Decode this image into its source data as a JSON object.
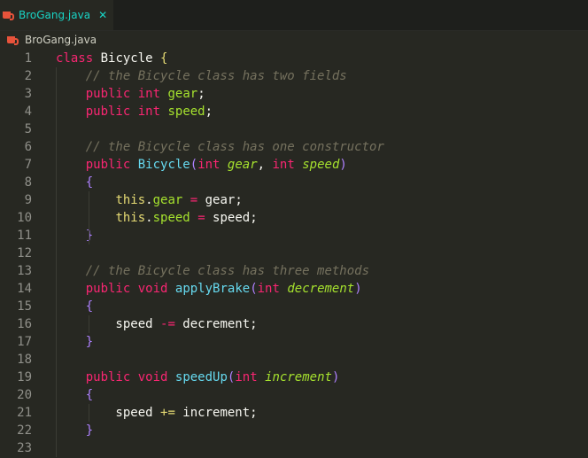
{
  "tab": {
    "label": "BroGang.java",
    "close_glyph": "✕",
    "icon": "java-file-icon"
  },
  "breadcrumb": {
    "label": "BroGang.java",
    "icon": "java-file-icon"
  },
  "editor": {
    "line_numbers": [
      "1",
      "2",
      "3",
      "4",
      "5",
      "6",
      "7",
      "8",
      "9",
      "10",
      "11",
      "12",
      "13",
      "14",
      "15",
      "16",
      "17",
      "18",
      "19",
      "20",
      "21",
      "22",
      "23"
    ],
    "lines": [
      [
        [
          "kw",
          "class"
        ],
        [
          "pl",
          " "
        ],
        [
          "cls",
          "Bicycle"
        ],
        [
          "pl",
          " "
        ],
        [
          "br",
          "{"
        ]
      ],
      [
        [
          "pl",
          "    "
        ],
        [
          "cm",
          "// the Bicycle class has two fields"
        ]
      ],
      [
        [
          "pl",
          "    "
        ],
        [
          "kw",
          "public"
        ],
        [
          "pl",
          " "
        ],
        [
          "ty",
          "int"
        ],
        [
          "pl",
          " "
        ],
        [
          "fd",
          "gear"
        ],
        [
          "pu",
          ";"
        ]
      ],
      [
        [
          "pl",
          "    "
        ],
        [
          "kw",
          "public"
        ],
        [
          "pl",
          " "
        ],
        [
          "ty",
          "int"
        ],
        [
          "pl",
          " "
        ],
        [
          "fd",
          "speed"
        ],
        [
          "pu",
          ";"
        ]
      ],
      [],
      [
        [
          "pl",
          "    "
        ],
        [
          "cm",
          "// the Bicycle class has one constructor"
        ]
      ],
      [
        [
          "pl",
          "    "
        ],
        [
          "kw",
          "public"
        ],
        [
          "pl",
          " "
        ],
        [
          "fn",
          "Bicycle"
        ],
        [
          "br2",
          "("
        ],
        [
          "ty",
          "int"
        ],
        [
          "pl",
          " "
        ],
        [
          "pa",
          "gear"
        ],
        [
          "pu",
          ", "
        ],
        [
          "ty",
          "int"
        ],
        [
          "pl",
          " "
        ],
        [
          "pa",
          "speed"
        ],
        [
          "br2",
          ")"
        ]
      ],
      [
        [
          "pl",
          "    "
        ],
        [
          "br2",
          "{"
        ]
      ],
      [
        [
          "pl",
          "        "
        ],
        [
          "br",
          "this"
        ],
        [
          "pu",
          "."
        ],
        [
          "fd",
          "gear"
        ],
        [
          "pl",
          " "
        ],
        [
          "op",
          "="
        ],
        [
          "pl",
          " gear"
        ],
        [
          "pu",
          ";"
        ]
      ],
      [
        [
          "pl",
          "        "
        ],
        [
          "br",
          "this"
        ],
        [
          "pu",
          "."
        ],
        [
          "fd",
          "speed"
        ],
        [
          "pl",
          " "
        ],
        [
          "op",
          "="
        ],
        [
          "pl",
          " speed"
        ],
        [
          "pu",
          ";"
        ]
      ],
      [
        [
          "pl",
          "    "
        ],
        [
          "br2",
          "}"
        ]
      ],
      [],
      [
        [
          "pl",
          "    "
        ],
        [
          "cm",
          "// the Bicycle class has three methods"
        ]
      ],
      [
        [
          "pl",
          "    "
        ],
        [
          "kw",
          "public"
        ],
        [
          "pl",
          " "
        ],
        [
          "kw",
          "void"
        ],
        [
          "pl",
          " "
        ],
        [
          "fn",
          "applyBrake"
        ],
        [
          "br2",
          "("
        ],
        [
          "ty",
          "int"
        ],
        [
          "pl",
          " "
        ],
        [
          "pa",
          "decrement"
        ],
        [
          "br2",
          ")"
        ]
      ],
      [
        [
          "pl",
          "    "
        ],
        [
          "br2",
          "{"
        ]
      ],
      [
        [
          "pl",
          "        speed "
        ],
        [
          "op",
          "-="
        ],
        [
          "pl",
          " decrement"
        ],
        [
          "pu",
          ";"
        ]
      ],
      [
        [
          "pl",
          "    "
        ],
        [
          "br2",
          "}"
        ]
      ],
      [],
      [
        [
          "pl",
          "    "
        ],
        [
          "kw",
          "public"
        ],
        [
          "pl",
          " "
        ],
        [
          "kw",
          "void"
        ],
        [
          "pl",
          " "
        ],
        [
          "fn",
          "speedUp"
        ],
        [
          "br2",
          "("
        ],
        [
          "ty",
          "int"
        ],
        [
          "pl",
          " "
        ],
        [
          "pa",
          "increment"
        ],
        [
          "br2",
          ")"
        ]
      ],
      [
        [
          "pl",
          "    "
        ],
        [
          "br2",
          "{"
        ]
      ],
      [
        [
          "pl",
          "        speed "
        ],
        [
          "br",
          "+="
        ],
        [
          "pl",
          " increment"
        ],
        [
          "pu",
          ";"
        ]
      ],
      [
        [
          "pl",
          "    "
        ],
        [
          "br2",
          "}"
        ]
      ],
      []
    ]
  },
  "colors": {
    "background": "#272822",
    "keyword": "#f92672",
    "class_name": "#f8f8f2",
    "field": "#a6e22e",
    "function": "#66d9ef",
    "comment": "#75715e",
    "tab_accent": "#19d3c5"
  }
}
